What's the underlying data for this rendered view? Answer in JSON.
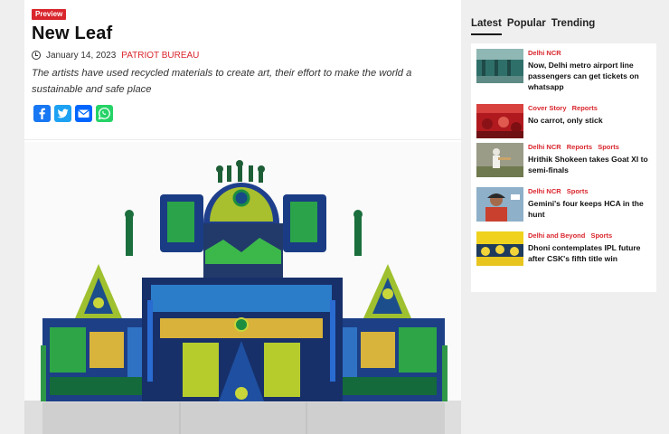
{
  "article": {
    "badge": "Preview",
    "title": "New Leaf",
    "date": "January 14, 2023",
    "author": "PATRIOT BUREAU",
    "summary": "The artists have used recycled materials to create art, their effort to make the world a sustainable and safe place",
    "share": [
      "facebook-icon",
      "twitter-icon",
      "email-icon",
      "whatsapp-icon"
    ]
  },
  "sidebar": {
    "tabs": [
      "Latest",
      "Popular",
      "Trending"
    ],
    "active_tab": "Latest",
    "items": [
      {
        "categories": [
          "Delhi NCR"
        ],
        "headline": "Now, Delhi metro airport line passengers can get tickets on whatsapp"
      },
      {
        "categories": [
          "Cover Story",
          "Reports"
        ],
        "headline": "No carrot, only stick"
      },
      {
        "categories": [
          "Delhi NCR",
          "Reports",
          "Sports"
        ],
        "headline": "Hrithik Shokeen takes Goat XI to semi-finals"
      },
      {
        "categories": [
          "Delhi NCR",
          "Sports"
        ],
        "headline": "Gemini's four keeps HCA in the hunt"
      },
      {
        "categories": [
          "Delhi and Beyond",
          "Sports"
        ],
        "headline": "Dhoni contemplates IPL future after CSK's fifth title win"
      }
    ]
  },
  "colors": {
    "accent": "#d9262d",
    "page_bg": "#efefef",
    "card_bg": "#ffffff"
  }
}
